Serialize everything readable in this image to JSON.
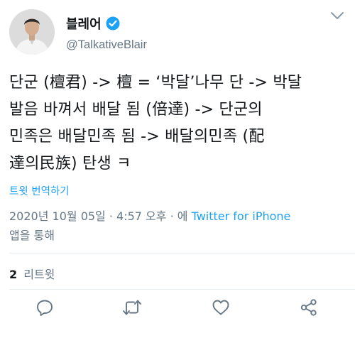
{
  "author": {
    "display_name": "블레어",
    "handle": "@TalkativeBlair",
    "verified": true,
    "verified_color": "#1da1f2",
    "avatar_icon": "user-avatar"
  },
  "tweet": {
    "lines": [
      "단군 (檀君) -> 檀 = ‘박달’나무 단 -> 박달",
      "발음 바껴서 배달 됨 (倍達) -> 단군의",
      "민족은 배달민족 됨 -> 배달의민족 (配",
      "達의民族) 탄생 ㅋ"
    ],
    "translate_label": "트윗 번역하기"
  },
  "meta": {
    "timestamp": "2020년 10월 05일 · 4:57 오후 ·",
    "via": "에",
    "source": "Twitter for iPhone",
    "source_suffix": "앱을 통해"
  },
  "stats": {
    "retweets": "2",
    "retweets_label": "리트윗"
  },
  "actions": {
    "icons": [
      "reply-icon",
      "retweet-icon",
      "like-icon",
      "share-icon"
    ]
  },
  "colors": {
    "text": "#14171a",
    "secondary": "#657786",
    "accent": "#1da1f2",
    "border": "#e6ecf0"
  }
}
